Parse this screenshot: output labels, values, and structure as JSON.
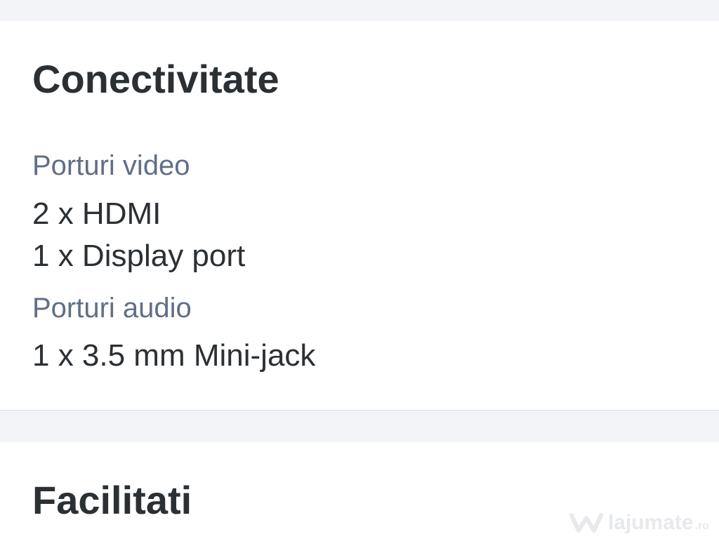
{
  "connectivity": {
    "title": "Conectivitate",
    "video_label": "Porturi video",
    "video_values": [
      "2 x HDMI",
      "1 x Display port"
    ],
    "audio_label": "Porturi audio",
    "audio_values": [
      "1 x 3.5 mm Mini-jack"
    ]
  },
  "facilities": {
    "title": "Facilitati"
  },
  "watermark": {
    "brand": "lajumate",
    "suffix": ".ro",
    "icon": "w-logo-icon"
  },
  "colors": {
    "page_bg": "#f2f4f7",
    "card_bg": "#ffffff",
    "heading_text": "#2b3034",
    "label_text": "#5f6f86",
    "divider": "#d9dde3"
  }
}
